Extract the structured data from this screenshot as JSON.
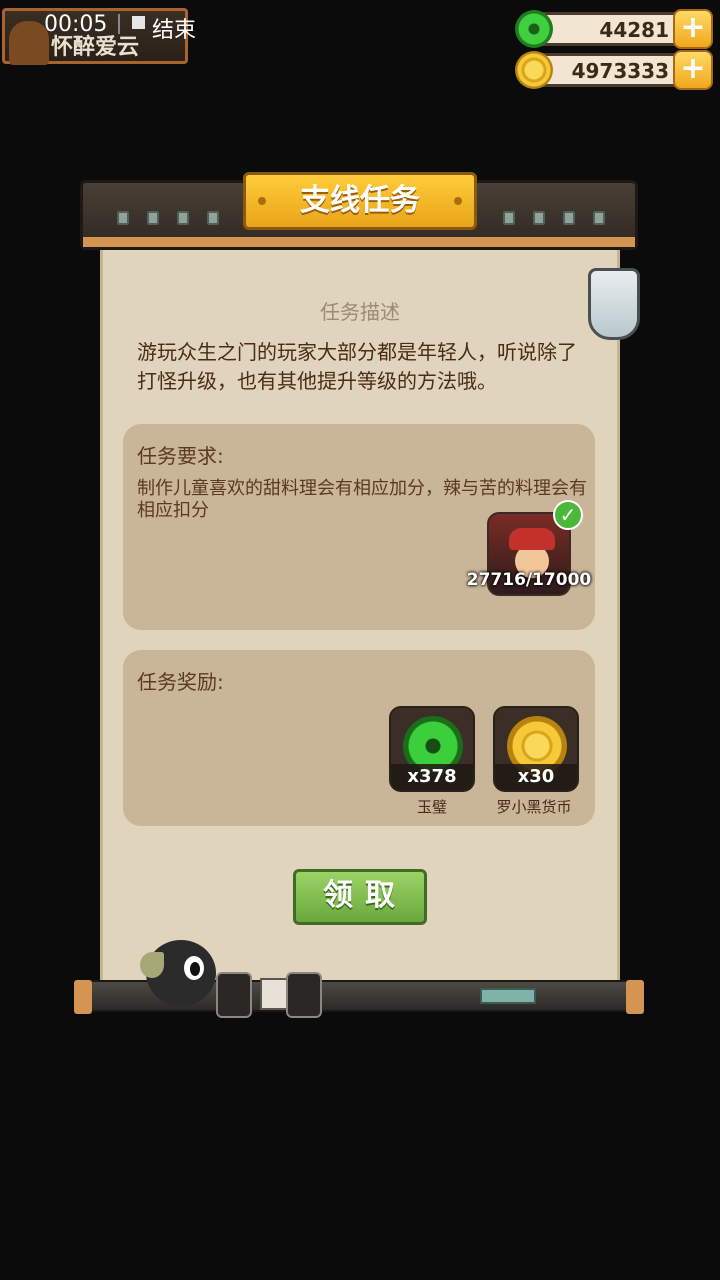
{
  "status": {
    "record_time": "00:05",
    "record_end": "结束",
    "player_name": "怀醉爱云"
  },
  "currency": {
    "jade_amount": "44281",
    "coin_amount": "4973333",
    "add_symbol": "+"
  },
  "panel": {
    "title": "支线任务",
    "description_title": "任务描述",
    "description": "游玩众生之门的玩家大部分都是年轻人，听说除了打怪升级，也有其他提升等级的方法哦。",
    "requirement_title": "任务要求:",
    "requirement_text": "制作儿童喜欢的甜料理会有相应加分，辣与苦的料理会有相应扣分",
    "requirement_progress": "27716/17000",
    "requirement_done_mark": "✓",
    "reward_title": "任务奖励:",
    "rewards": [
      {
        "qty": "x378",
        "name": "玉璧",
        "icon": "jade-disc-icon"
      },
      {
        "qty": "x30",
        "name": "罗小黑货币",
        "icon": "gold-coin-icon"
      }
    ],
    "claim_label": "领取"
  },
  "colors": {
    "paper": "#e1d4bd",
    "title_plate": "#f2b52a",
    "claim_button": "#7fbf4f",
    "box": "#c9b597"
  }
}
